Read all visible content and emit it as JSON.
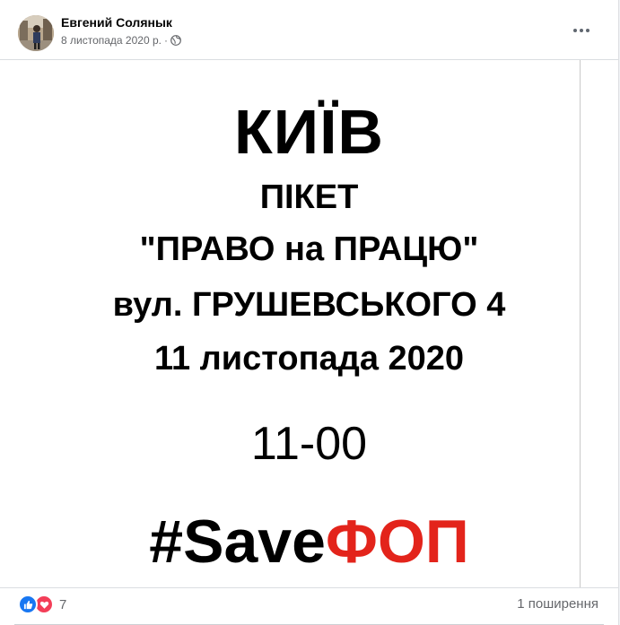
{
  "post": {
    "author": "Евгений Солянык",
    "date": "8 листопада 2020 р.",
    "separator": "·",
    "privacy_icon": "globe-icon",
    "more_icon": "more-options-icon"
  },
  "poster": {
    "city": "КИЇВ",
    "picket": "ПІКЕТ",
    "title": "\"ПРАВО на ПРАЦЮ\"",
    "street": "вул. ГРУШЕВСЬКОГО  4",
    "date": "11 листопада 2020",
    "time": "11-00",
    "hashtag_black": "#Save",
    "hashtag_red": "ФОП",
    "hashtag_red_color": "#e3241b"
  },
  "footer": {
    "reaction_icons": [
      "like-icon",
      "love-icon"
    ],
    "reaction_count": "7",
    "shares": "1 поширення"
  },
  "colors": {
    "like": "#1877f2",
    "love": "#f33e58",
    "meta_text": "#65676b"
  }
}
